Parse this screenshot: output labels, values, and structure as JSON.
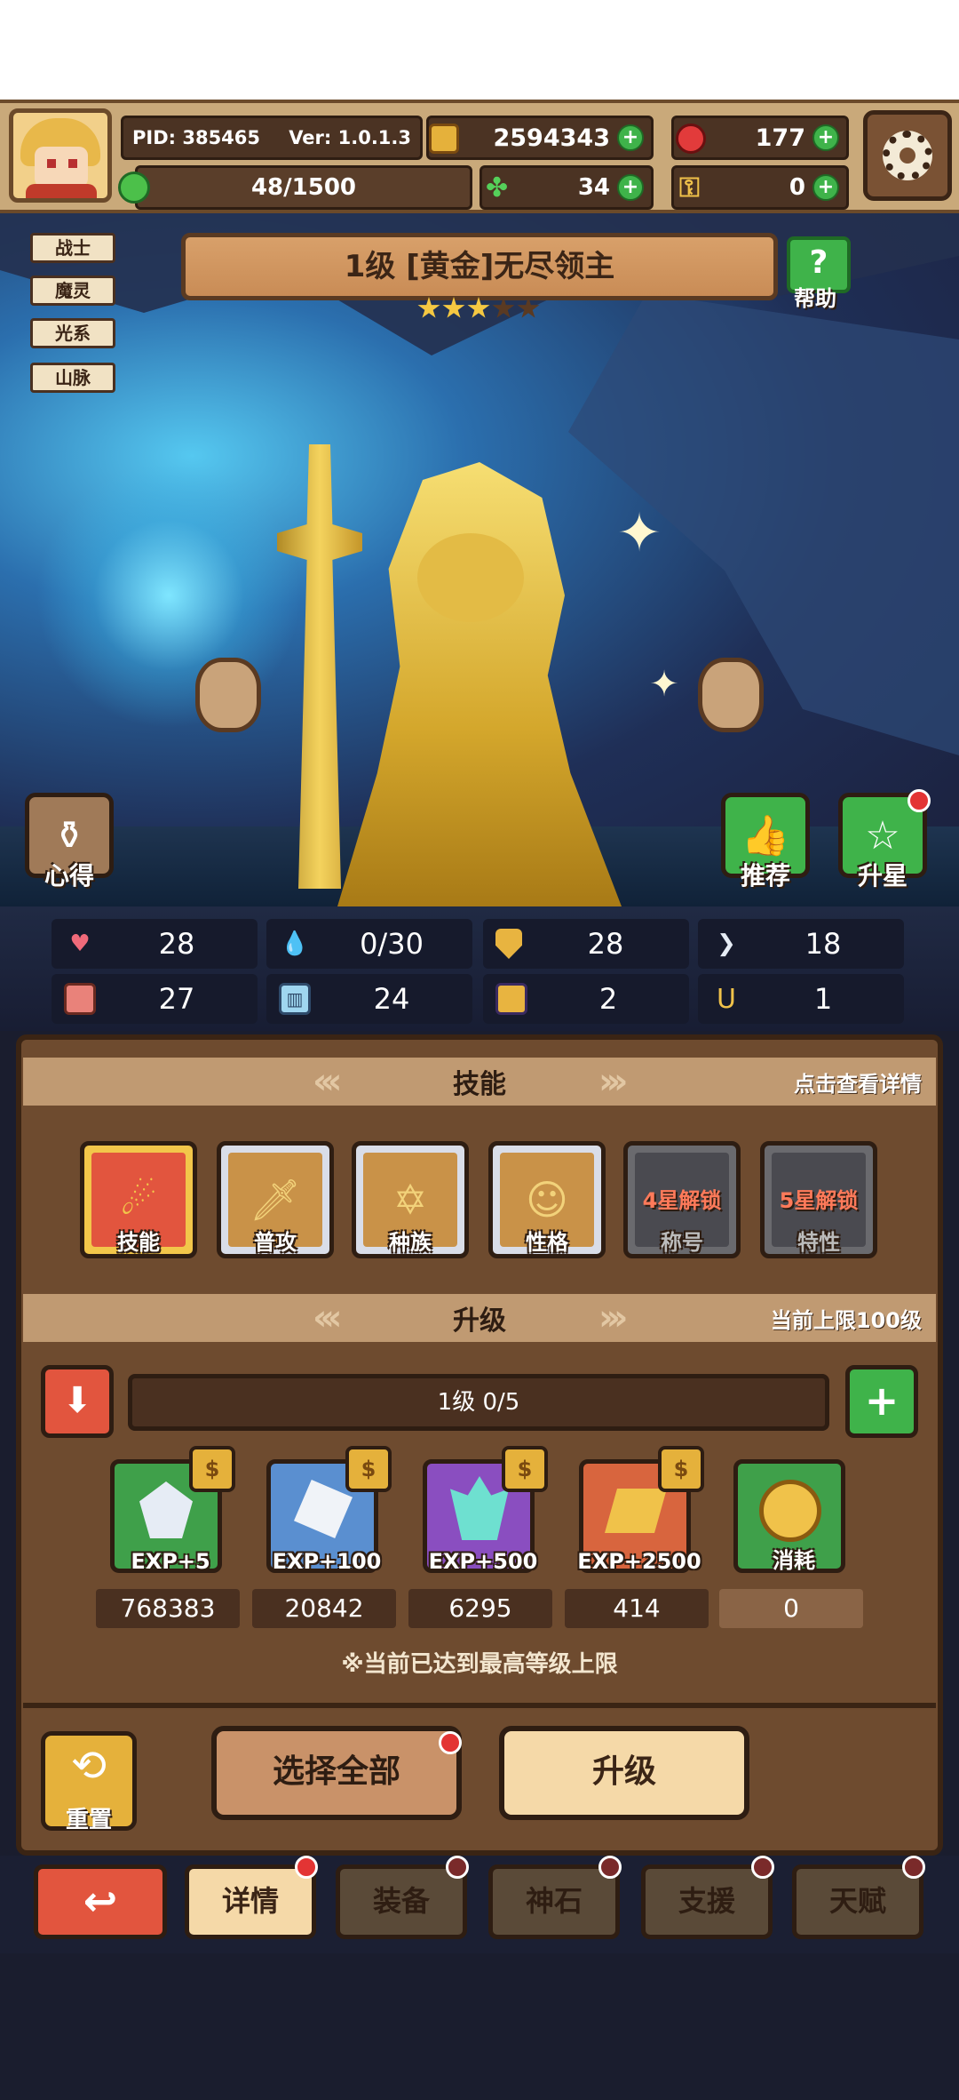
{
  "top": {
    "pid": "PID: 385465",
    "version": "Ver: 1.0.1.3",
    "gold": "2594343",
    "gems": "177",
    "stamina": "48/1500",
    "clover": "34",
    "key": "0"
  },
  "tags": [
    "战士",
    "魔灵",
    "光系",
    "山脉"
  ],
  "hero": {
    "title": "1级 [黄金]无尽领主",
    "stars_filled": 3,
    "stars_total": 5
  },
  "scene_buttons": {
    "help": "帮助",
    "insight": "心得",
    "recommend": "推荐",
    "star_up": "升星"
  },
  "stats": [
    {
      "icon": "heart-icon",
      "value": "28"
    },
    {
      "icon": "water-drop-icon",
      "value": "0/30"
    },
    {
      "icon": "shield-icon",
      "value": "28"
    },
    {
      "icon": "wing-icon",
      "value": "18"
    },
    {
      "icon": "fist-icon",
      "value": "27"
    },
    {
      "icon": "book-icon",
      "value": "24"
    },
    {
      "icon": "scroll-icon",
      "value": "2"
    },
    {
      "icon": "horseshoe-icon",
      "value": "1"
    }
  ],
  "skills_section": {
    "title": "技能",
    "hint": "点击查看详情",
    "items": [
      {
        "label": "技能",
        "lock": ""
      },
      {
        "label": "普攻",
        "lock": ""
      },
      {
        "label": "种族",
        "lock": ""
      },
      {
        "label": "性格",
        "lock": ""
      },
      {
        "label": "称号",
        "lock": "4星解锁"
      },
      {
        "label": "特性",
        "lock": "5星解锁"
      }
    ]
  },
  "upgrade_section": {
    "title": "升级",
    "hint": "当前上限100级",
    "level_text": "1级  0/5",
    "level_progress": 0,
    "items": [
      {
        "label": "EXP+5",
        "count": "768383"
      },
      {
        "label": "EXP+100",
        "count": "20842"
      },
      {
        "label": "EXP+500",
        "count": "6295"
      },
      {
        "label": "EXP+2500",
        "count": "414"
      },
      {
        "label": "消耗",
        "count": "0"
      }
    ],
    "notice": "※当前已达到最高等级上限"
  },
  "actions": {
    "reset": "重置",
    "select_all": "选择全部",
    "upgrade": "升级"
  },
  "nav": {
    "details": "详情",
    "equipment": "装备",
    "godstone": "神石",
    "support": "支援",
    "talent": "天赋"
  }
}
